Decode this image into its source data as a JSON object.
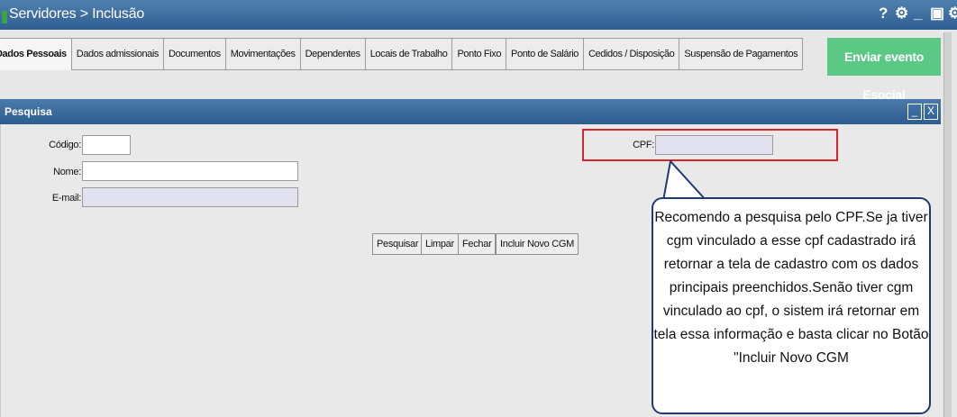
{
  "window": {
    "title": "Servidores > Inclusão",
    "controls": [
      "?",
      "⚙",
      "_",
      "▣",
      "⚙"
    ]
  },
  "tabs": [
    {
      "label": "Dados Pessoais",
      "active": true
    },
    {
      "label": "Dados admissionais"
    },
    {
      "label": "Documentos"
    },
    {
      "label": "Movimentações"
    },
    {
      "label": "Dependentes"
    },
    {
      "label": "Locais de Trabalho"
    },
    {
      "label": "Ponto Fixo"
    },
    {
      "label": "Ponto de Salário"
    },
    {
      "label": "Cedidos / Disposição"
    },
    {
      "label": "Suspensão de Pagamentos"
    }
  ],
  "esocial_button": "Enviar evento Esocial",
  "panel": {
    "title": "Pesquisa",
    "minimize": "_",
    "close": "X"
  },
  "form": {
    "codigo_label": "Código:",
    "codigo_value": "",
    "nome_label": "Nome:",
    "nome_value": "",
    "email_label": "E-mail:",
    "email_value": "",
    "cpf_label": "CPF:",
    "cpf_value": ""
  },
  "buttons": {
    "pesquisar": "Pesquisar",
    "limpar": "Limpar",
    "fechar": "Fechar",
    "incluir": "Incluir Novo CGM"
  },
  "callout": {
    "text": "Recomendo a pesquisa pelo CPF.Se ja tiver cgm vinculado a esse cpf cadastrado irá retornar a tela de cadastro com os dados principais preenchidos.Senão tiver cgm vinculado ao cpf, o sistem irá retornar em tela essa informação e basta clicar no Botão \"Incluir Novo CGM"
  },
  "colors": {
    "header_blue": "#2f5f91",
    "esocial_green": "#5bc886",
    "highlight_red": "#d9252a",
    "callout_border": "#1f3a6e"
  }
}
